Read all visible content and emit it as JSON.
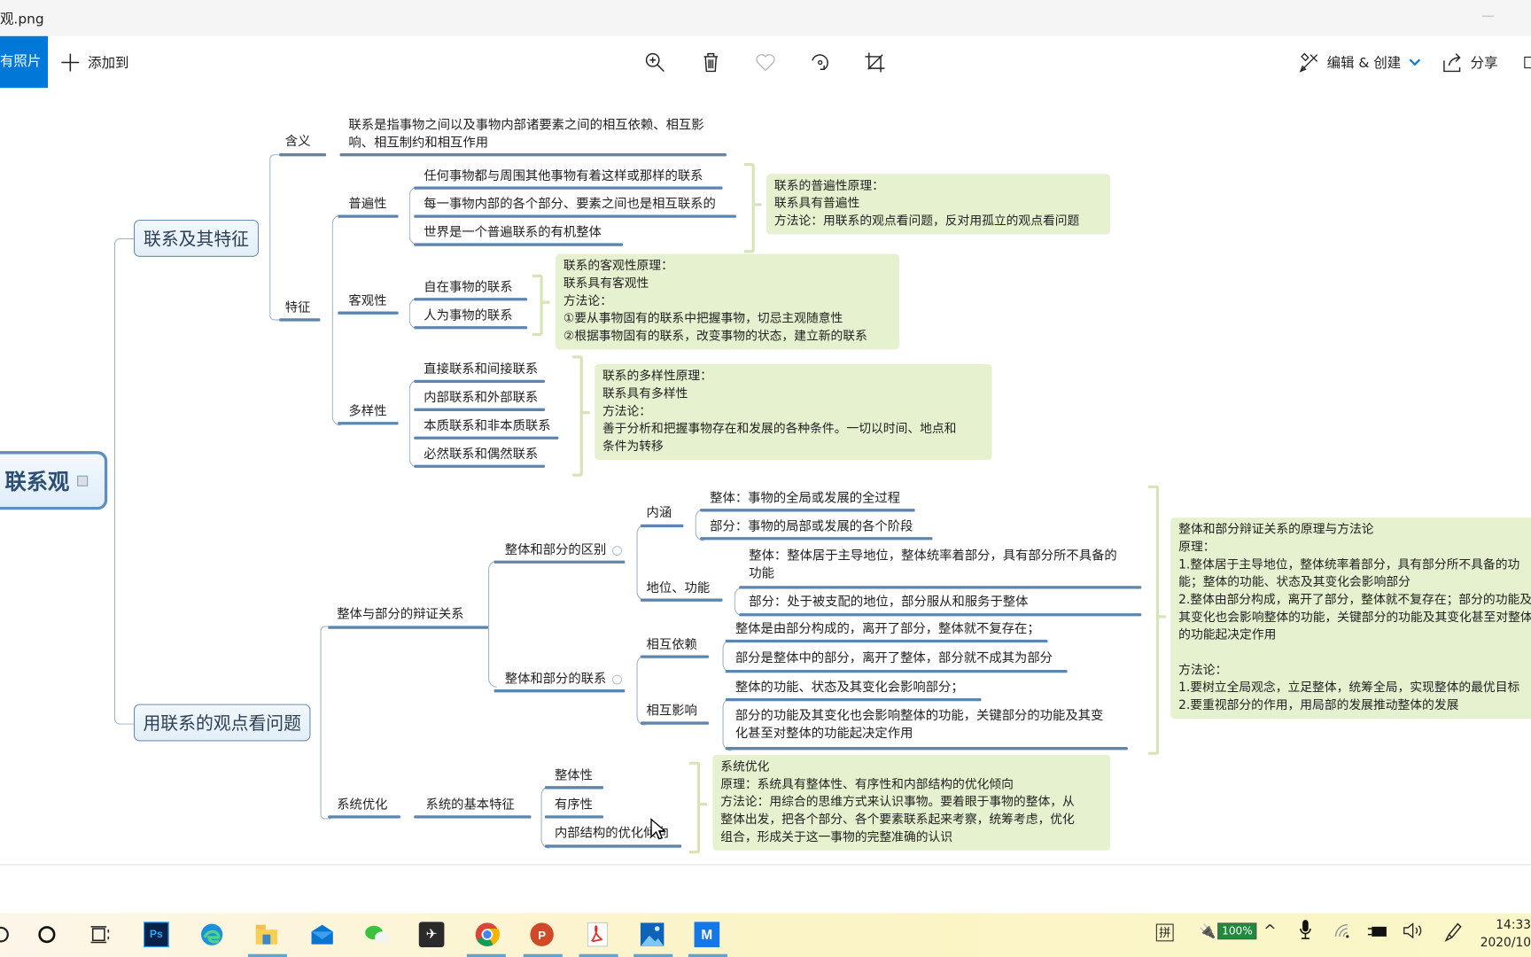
{
  "window": {
    "title": "观.png",
    "minimize_label": "—"
  },
  "toolbar": {
    "all_photos": "有照片",
    "add_to": "添加到",
    "edit_create": "编辑 & 创建",
    "share": "分享",
    "icons": [
      "zoom-in-icon",
      "delete-icon",
      "favorite-icon",
      "rotate-icon",
      "crop-icon"
    ]
  },
  "mindmap": {
    "root": "联系观",
    "branch1": {
      "title": "联系及其特征",
      "meaning_label": "含义",
      "meaning_text": "联系是指事物之间以及事物内部诸要素之间的相互依赖、相互影\n响、相互制约和相互作用",
      "features_label": "特征",
      "universal": {
        "label": "普遍性",
        "items": [
          "任何事物都与周围其他事物有着这样或那样的联系",
          "每一事物内部的各个部分、要素之间也是相互联系的",
          "世界是一个普遍联系的有机整体"
        ],
        "note": "联系的普遍性原理：\n联系具有普遍性\n方法论：用联系的观点看问题，反对用孤立的观点看问题"
      },
      "objective": {
        "label": "客观性",
        "items": [
          "自在事物的联系",
          "人为事物的联系"
        ],
        "note": "联系的客观性原理：\n联系具有客观性\n方法论：\n①要从事物固有的联系中把握事物，切忌主观随意性\n②根据事物固有的联系，改变事物的状态，建立新的联系"
      },
      "diversity": {
        "label": "多样性",
        "items": [
          "直接联系和间接联系",
          "内部联系和外部联系",
          "本质联系和非本质联系",
          "必然联系和偶然联系"
        ],
        "note": "联系的多样性原理：\n联系具有多样性\n方法论：\n善于分析和把握事物存在和发展的各种条件。一切以时间、地点和\n条件为转移"
      }
    },
    "branch2": {
      "title": "用联系的观点看问题",
      "dialectic": {
        "label": "整体与部分的辩证关系",
        "difference": {
          "label": "整体和部分的区别",
          "connotation_label": "内涵",
          "connotation_items": [
            "整体：事物的全局或发展的全过程",
            "部分：事物的局部或发展的各个阶段"
          ],
          "status_label": "地位、功能",
          "status_items": [
            "整体：整体居于主导地位，整体统率着部分，具有部分所不具备的\n功能",
            "部分：处于被支配的地位，部分服从和服务于整体"
          ]
        },
        "connection": {
          "label": "整体和部分的联系",
          "interdependence_label": "相互依赖",
          "interdependence_items": [
            "整体是由部分构成的，离开了部分，整体就不复存在；",
            "部分是整体中的部分，离开了整体，部分就不成其为部分"
          ],
          "interaction_label": "相互影响",
          "interaction_items": [
            "整体的功能、状态及其变化会影响部分；",
            "部分的功能及其变化也会影响整体的功能，关键部分的功能及其变\n化甚至对整体的功能起决定作用"
          ]
        },
        "note": "整体和部分辩证关系的原理与方法论\n原理：\n1.整体居于主导地位，整体统率着部分，具有部分所不具备的功\n能；整体的功能、状态及其变化会影响部分\n2.整体由部分构成，离开了部分，整体就不复存在；部分的功能及\n其变化也会影响整体的功能，关键部分的功能及其变化甚至对整体\n的功能起决定作用\n\n方法论：\n1.要树立全局观念，立足整体，统筹全局，实现整体的最优目标\n2.要重视部分的作用，用局部的发展推动整体的发展"
      },
      "system": {
        "label": "系统优化",
        "features_label": "系统的基本特征",
        "items": [
          "整体性",
          "有序性",
          "内部结构的优化倾向"
        ],
        "note": "系统优化\n原理：系统具有整体性、有序性和内部结构的优化倾向\n方法论：用综合的思维方式来认识事物。要着眼于事物的整体，从\n整体出发，把各个部分、各个要素联系起来考察，统筹考虑，优化\n组合，形成关于这一事物的完整准确的认识"
      }
    }
  },
  "taskbar": {
    "apps": [
      "cortana",
      "task-view",
      "photoshop",
      "edge",
      "file-explorer",
      "mail",
      "wechat",
      "app-bird",
      "chrome",
      "powerpoint",
      "acrobat",
      "photos",
      "app-blue"
    ],
    "ime": "拼",
    "battery": "100%",
    "time": "14:33",
    "date": "2020/10"
  },
  "colors": {
    "accent": "#0078d7",
    "node_underline": "#5d85ad",
    "note_bg": "#e6f2cf",
    "battery_green": "#1e8a3c"
  }
}
